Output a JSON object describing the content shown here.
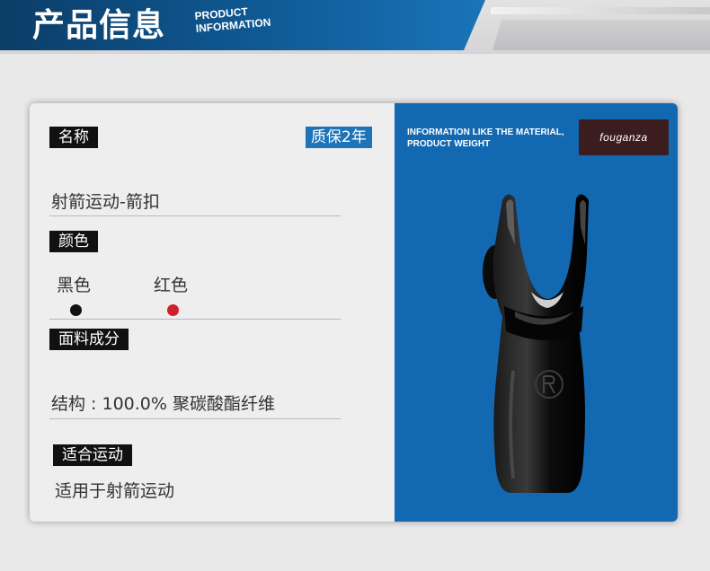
{
  "header": {
    "title": "产品信息",
    "subtitle_line1": "PRODUCT",
    "subtitle_line2": "INFORMATION"
  },
  "specs": {
    "name_label": "名称",
    "warranty": "质保2年",
    "name_value": "射箭运动-箭扣",
    "color_label": "颜色",
    "colors": [
      {
        "name": "黑色",
        "swatch": "#111111"
      },
      {
        "name": "红色",
        "swatch": "#d0202a"
      }
    ],
    "material_label": "面料成分",
    "material_value": "结构 : 100.0% 聚碳酸酯纤维",
    "usage_label": "适合运动",
    "usage_value": "适用于射箭运动"
  },
  "panel": {
    "info_line1": "INFORMATION LIKE THE MATERIAL,",
    "info_line2": "PRODUCT WEIGHT",
    "brand": "fouganza",
    "image_icon": "arrow-nock-icon"
  },
  "colors": {
    "header_blue": "#0f5a96",
    "panel_blue": "#1268b1",
    "warranty_blue": "#1f73b8",
    "label_black": "#111111"
  }
}
